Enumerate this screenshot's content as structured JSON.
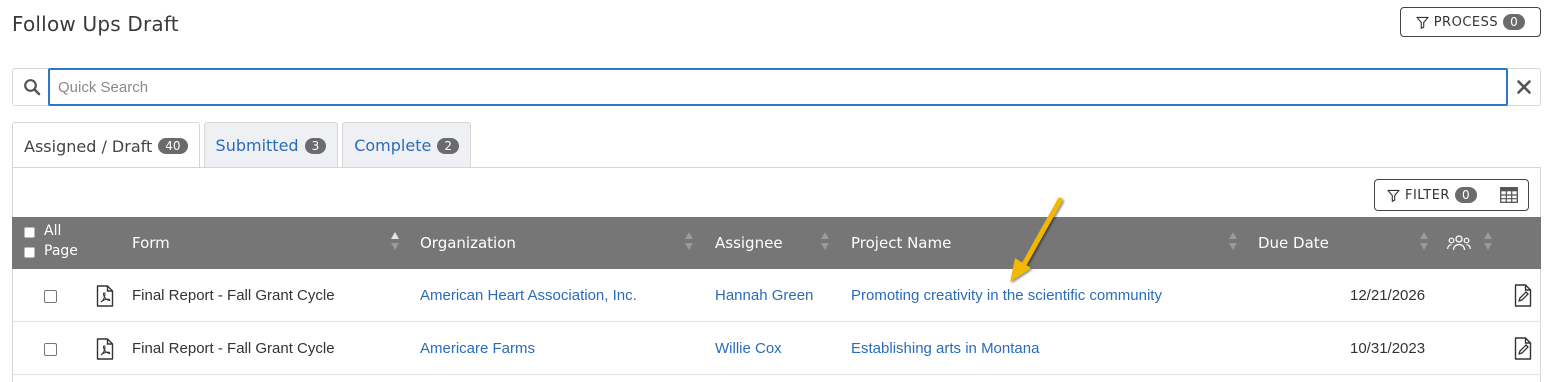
{
  "page": {
    "title": "Follow Ups Draft"
  },
  "process": {
    "label": "PROCESS",
    "count": "0"
  },
  "search": {
    "placeholder": "Quick Search",
    "value": ""
  },
  "tabs": [
    {
      "label": "Assigned / Draft",
      "count": "40",
      "active": true
    },
    {
      "label": "Submitted",
      "count": "3",
      "active": false
    },
    {
      "label": "Complete",
      "count": "2",
      "active": false
    }
  ],
  "filter": {
    "label": "FILTER",
    "count": "0"
  },
  "table": {
    "select": {
      "all": "All",
      "page": "Page"
    },
    "columns": {
      "form": "Form",
      "organization": "Organization",
      "assignee": "Assignee",
      "project": "Project Name",
      "due_date": "Due Date"
    },
    "rows": [
      {
        "form": "Final Report - Fall Grant Cycle",
        "organization": "American Heart Association, Inc.",
        "assignee": "Hannah Green",
        "project": "Promoting creativity in the scientific community",
        "due_date": "12/21/2026"
      },
      {
        "form": "Final Report - Fall Grant Cycle",
        "organization": "Americare Farms",
        "assignee": "Willie Cox",
        "project": "Establishing arts in Montana",
        "due_date": "10/31/2023"
      }
    ]
  },
  "colors": {
    "accent": "#2c78c6",
    "link": "#2a6cb8",
    "header_bg": "#767676",
    "annotation_arrow": "#f2b705"
  }
}
